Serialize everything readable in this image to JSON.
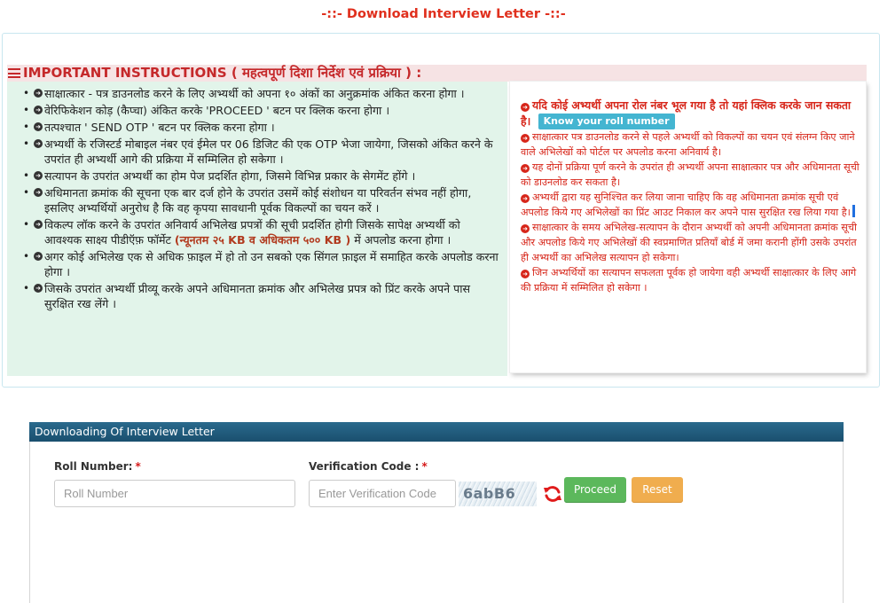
{
  "page_title": "-::- Download Interview Letter -::-",
  "instructions": {
    "header": "IMPORTANT INSTRUCTIONS ( महत्वपूर्ण दिशा निर्देश एवं प्रक्रिया ) :",
    "left_items": [
      "साक्षात्कार - पत्र डाउनलोड करने के लिए अभ्यर्थी को अपना १० अंकों का अनुक्रमांक अंकित करना होगा ।",
      "वेरिफिकेशन कोड़ (कैप्चा) अंकित करके 'PROCEED ' बटन पर क्लिक करना होगा ।",
      "तत्पश्चात ' SEND OTP ' बटन पर क्लिक करना होगा ।",
      "अभ्यर्थी के रजिस्टर्ड मोबाइल नंबर एवं ईमेल पर 06 डिजिट की एक OTP भेजा जायेगा, जिसको अंकित करने के उपरांत ही अभ्यर्थी आगे की प्रक्रिया में सम्मिलित हो सकेगा ।",
      "सत्यापन के उपरांत अभ्यर्थी का होम पेज प्रदर्शित होगा, जिसमे विभिन्न प्रकार के सेगमेंट होंगे ।",
      "अधिमानता क्रमांक की सूचना एक बार दर्ज होने के उपरांत उसमें कोई संशोधन या परिवर्तन संभव नहीं होगा, इसलिए अभ्यर्थियों अनुरोध है कि वह कृपया सावधानी पूर्वक विकल्पों का चयन करें ।",
      "अगर कोई अभिलेख एक से अधिक फ़ाइल में हो तो उन सबको एक सिंगल फ़ाइल में समाहित करके अपलोड करना होगा ।",
      "जिसके उपरांत अभ्यर्थी प्रीव्यू करके अपने अधिमानता क्रमांक और अभिलेख प्रपत्र को प्रिंट करके अपने पास सुरक्षित रख लेंगे ।"
    ],
    "lock_item": {
      "before": "विकल्प लॉक करने के उपरांत अनिवार्य अभिलेख प्रपत्रों की सूची प्रदर्शित होगी जिसके सापेक्ष अभ्यर्थी को आवश्यक साक्ष्य पीडीऍफ़ फॉर्मेट ",
      "highlight": "(न्यूनतम २५ KB व अधिकतम ५०० KB )",
      "after": " में अपलोड करना होगा ।"
    },
    "right_lead": "यदि कोई अभ्यर्थी अपना रोल नंबर भूल गया है तो यहां क्लिक करके जान सकता है।",
    "know_roll_button": "Know your roll number",
    "right_items": [
      "साक्षात्कार पत्र डाउनलोड करने से पहले अभ्यर्थी को विकल्पों का चयन एवं संलग्न किए जाने वाले अभिलेखों को पोर्टल पर अपलोड करना अनिवार्य है।",
      "यह दोनों प्रक्रिया पूर्ण करने के उपरांत ही अभ्यर्थी अपना साक्षात्कार पत्र और अधिमानता सूची को डाउनलोड कर सकता है।",
      "अभ्यर्थी द्वारा यह सुनिश्चित कर लिया जाना चाहिए कि वह अधिमानता क्रमांक सूची एवं अपलोड किये गए अभिलेखों का प्रिंट आउट निकाल कर अपने पास सुरक्षित रख लिया गया है।",
      "साक्षात्कार के समय अभिलेख-सत्यापन के दौरान अभ्यर्थी को अपनी अधिमानता क्रमांक सूची और अपलोड किये गए अभिलेखों की स्वप्रमाणित प्रतियाँ बोर्ड में जमा करानी होंगी उसके उपरांत ही अभ्यर्थी का अभिलेख सत्यापन हो सकेगा।",
      "जिन अभ्यर्थियों का सत्यापन सफलता पूर्वक हो जायेगा वही अभ्यर्थी साक्षात्कार के लिए आगे की प्रक्रिया में सम्मिलित हो सकेगा ।"
    ]
  },
  "form": {
    "heading": "Downloading Of Interview Letter",
    "roll_label": "Roll Number:",
    "verification_label": "Verification Code :",
    "required_mark": "*",
    "roll_placeholder": "Roll Number",
    "verification_placeholder": "Enter Verification Code",
    "captcha_text": "6abB6",
    "proceed_label": "Proceed",
    "reset_label": "Reset"
  },
  "colors": {
    "title_red": "#e0301e",
    "instruction_red": "#d7261a",
    "left_panel_bg": "#e2f4ea",
    "form_header": "#1a4f6e",
    "proceed_green": "#5cb85c",
    "reset_orange": "#f0ad4e"
  },
  "icons": [
    "list-icon",
    "circle-arrow-icon",
    "refresh-icon"
  ]
}
